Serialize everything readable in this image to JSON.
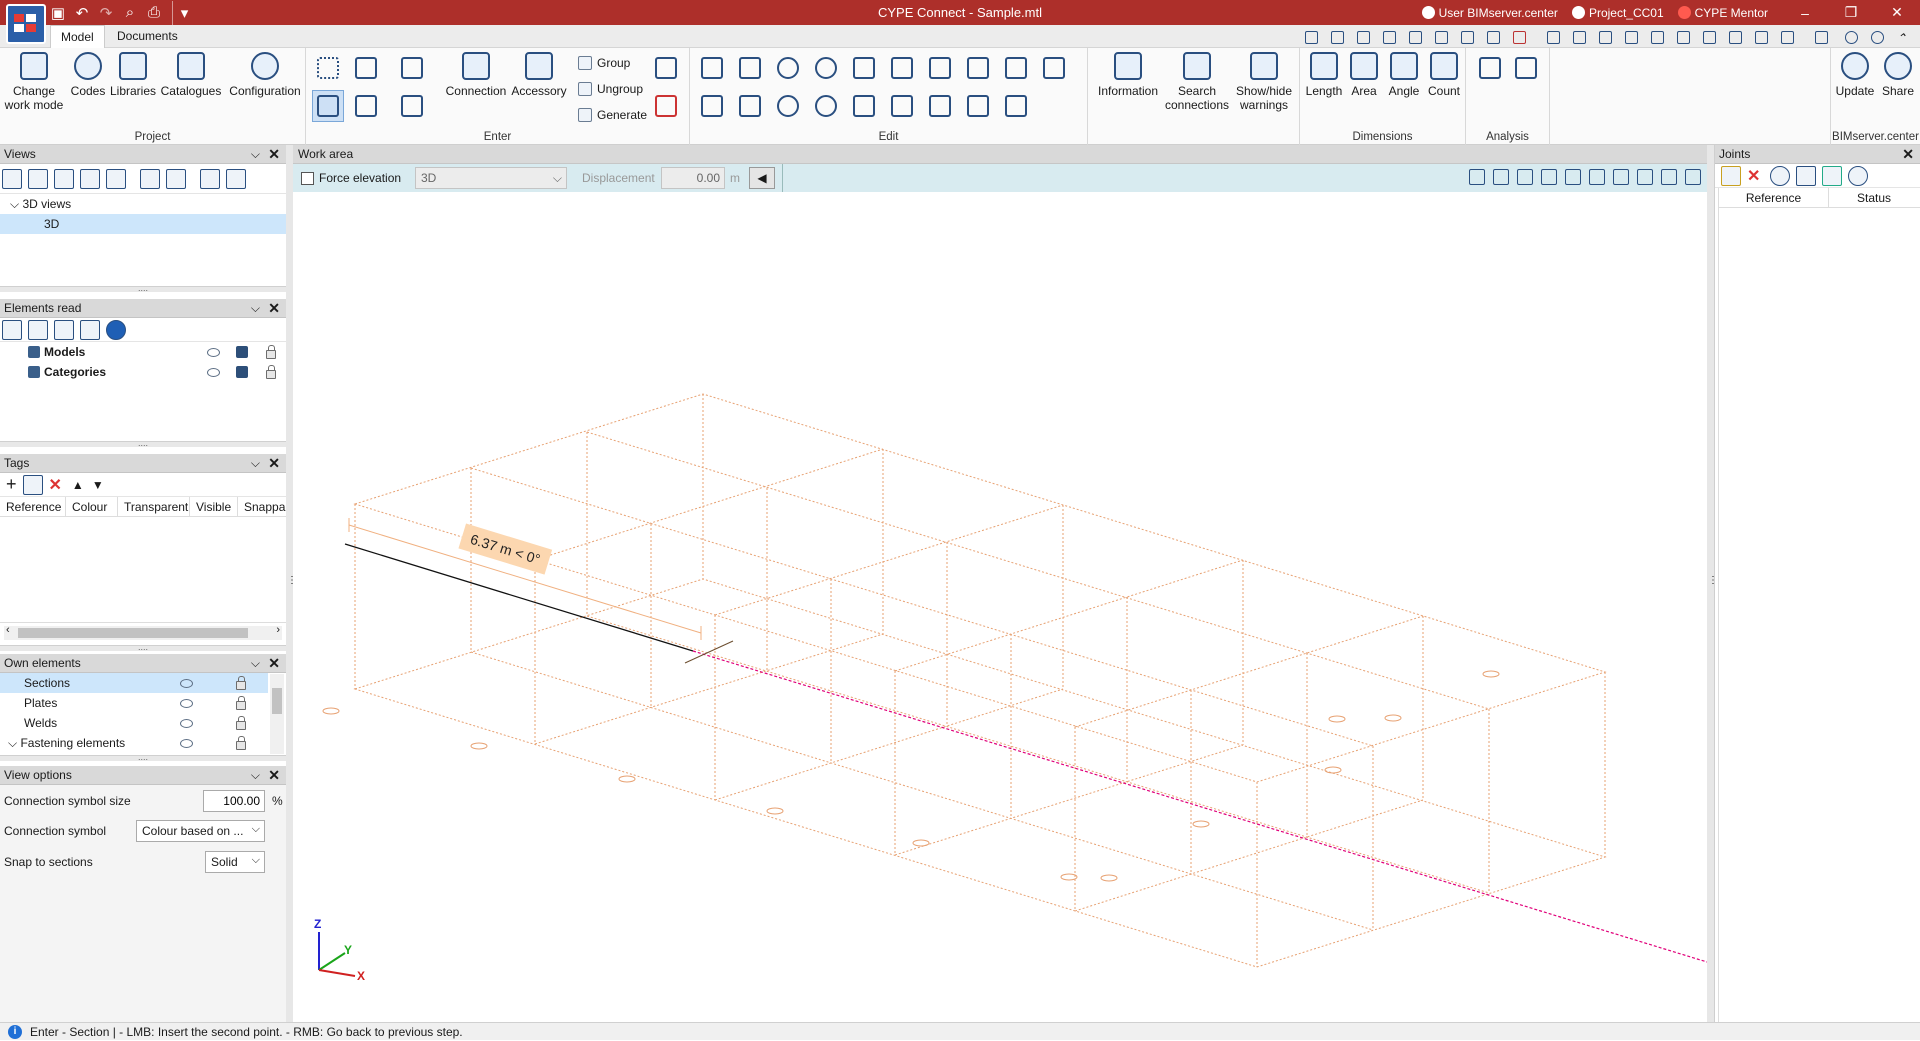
{
  "window": {
    "title": "CYPE Connect - Sample.mtl",
    "user_link": "User BIMserver.center",
    "project_link": "Project_CC01",
    "mentor_link": "CYPE Mentor"
  },
  "tabs": [
    "Model",
    "Documents"
  ],
  "ribbon": {
    "project": {
      "label": "Project",
      "buttons": [
        "Change work mode",
        "Codes",
        "Libraries",
        "Catalogues",
        "Configuration"
      ]
    },
    "enter": {
      "label": "Enter",
      "buttons": [
        "Connection",
        "Accessory"
      ],
      "small": [
        "Group",
        "Ungroup",
        "Generate"
      ]
    },
    "edit": {
      "label": "Edit"
    },
    "info": {
      "buttons": [
        "Information",
        "Search connections",
        "Show/hide warnings"
      ]
    },
    "dimensions": {
      "label": "Dimensions",
      "buttons": [
        "Length",
        "Area",
        "Angle",
        "Count"
      ]
    },
    "analysis": {
      "label": "Analysis"
    },
    "bimserver": {
      "label": "BIMserver.center",
      "buttons": [
        "Update",
        "Share"
      ]
    }
  },
  "views": {
    "title": "Views",
    "tree": [
      "3D views",
      "3D"
    ]
  },
  "elements_read": {
    "title": "Elements read",
    "items": [
      "Models",
      "Categories"
    ]
  },
  "tags": {
    "title": "Tags",
    "columns": [
      "Reference",
      "Colour",
      "Transparent",
      "Visible",
      "Snappa"
    ]
  },
  "own_elements": {
    "title": "Own elements",
    "items": [
      "Sections",
      "Plates",
      "Welds",
      "Fastening elements"
    ]
  },
  "view_options": {
    "title": "View options",
    "connection_symbol_size_label": "Connection symbol size",
    "connection_symbol_size": "100.00",
    "unit": "%",
    "connection_symbol_label": "Connection symbol",
    "connection_symbol": "Colour based on ...",
    "snap_label": "Snap to sections",
    "snap": "Solid"
  },
  "work_area": {
    "title": "Work area",
    "force_elevation": "Force elevation",
    "view": "3D",
    "displacement_label": "Displacement",
    "displacement": "0.00",
    "unit": "m",
    "dimension_label": "6.37 m < 0°",
    "axes": {
      "z": "Z",
      "y": "Y",
      "x": "X"
    }
  },
  "joints": {
    "title": "Joints",
    "columns": [
      "Reference",
      "Status"
    ]
  },
  "status": {
    "text": "Enter - Section  |  - LMB: Insert the second point. - RMB: Go back to previous step."
  },
  "colors": {
    "titlebar": "#ad2f2a",
    "grid": "#e8a070",
    "magenta": "#e0007a",
    "selection": "#cde6fb"
  }
}
